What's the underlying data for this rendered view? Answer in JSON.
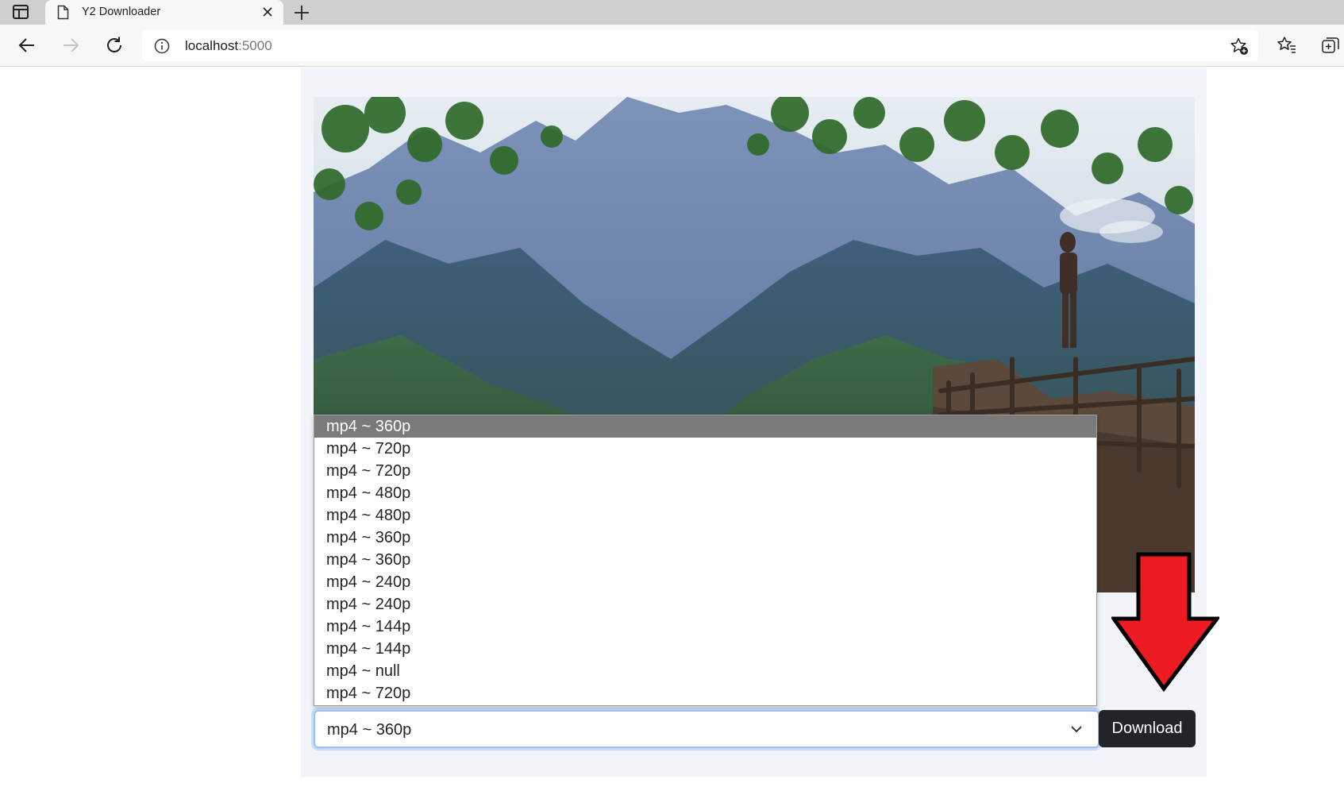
{
  "browser": {
    "tab_title": "Y2 Downloader",
    "url_host": "localhost",
    "url_port": ":5000",
    "icons": [
      "sidebar-icon",
      "page-icon",
      "close-icon",
      "plus-icon",
      "back-icon",
      "forward-icon",
      "refresh-icon",
      "info-icon",
      "favorite-add-icon",
      "favorites-icon",
      "collections-icon"
    ]
  },
  "main": {
    "thumbnail_alt": "Video thumbnail",
    "select": {
      "value": "mp4 ~ 360p",
      "options": [
        "mp4 ~ 360p",
        "mp4 ~ 720p",
        "mp4 ~ 720p",
        "mp4 ~ 480p",
        "mp4 ~ 480p",
        "mp4 ~ 360p",
        "mp4 ~ 360p",
        "mp4 ~ 240p",
        "mp4 ~ 240p",
        "mp4 ~ 144p",
        "mp4 ~ 144p",
        "mp4 ~ null",
        "mp4 ~ 720p"
      ],
      "highlighted_index": 0
    },
    "download_label": "Download"
  },
  "colors": {
    "card_bg": "#f1f4f9",
    "button_bg": "#212529",
    "highlight_bg": "#7a7a7a",
    "annotation_arrow": "#ed1c24"
  }
}
